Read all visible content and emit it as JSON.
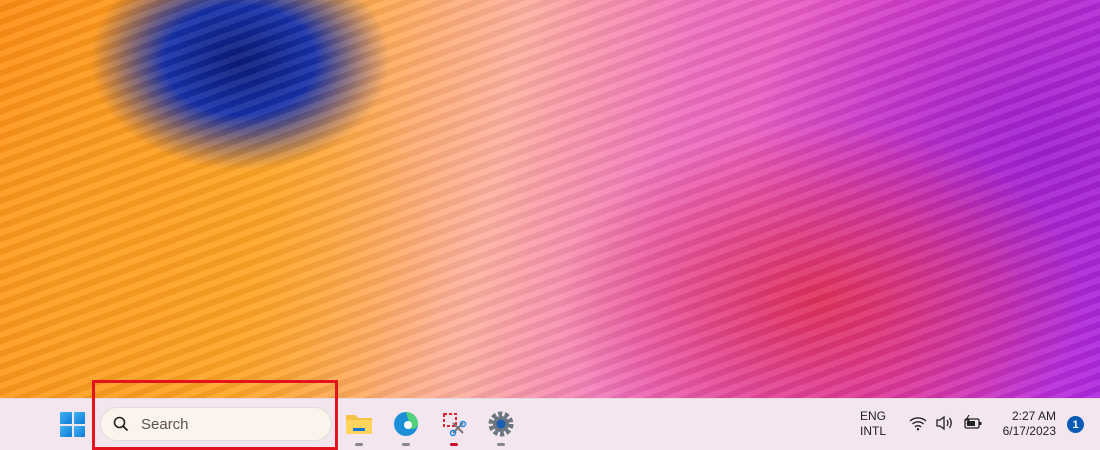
{
  "taskbar": {
    "search": {
      "placeholder": "Search"
    },
    "apps": [
      {
        "name": "File Explorer",
        "icon": "folder-icon"
      },
      {
        "name": "Microsoft Edge",
        "icon": "edge-icon"
      },
      {
        "name": "Snipping Tool",
        "icon": "snipping-tool-icon"
      },
      {
        "name": "Settings",
        "icon": "gear-icon"
      }
    ],
    "tray": {
      "lang_line1": "ENG",
      "lang_line2": "INTL",
      "time": "2:27 AM",
      "date": "6/17/2023",
      "notification_count": "1"
    }
  },
  "colors": {
    "annotation": "#e3141e",
    "accent": "#0a5bb5"
  }
}
